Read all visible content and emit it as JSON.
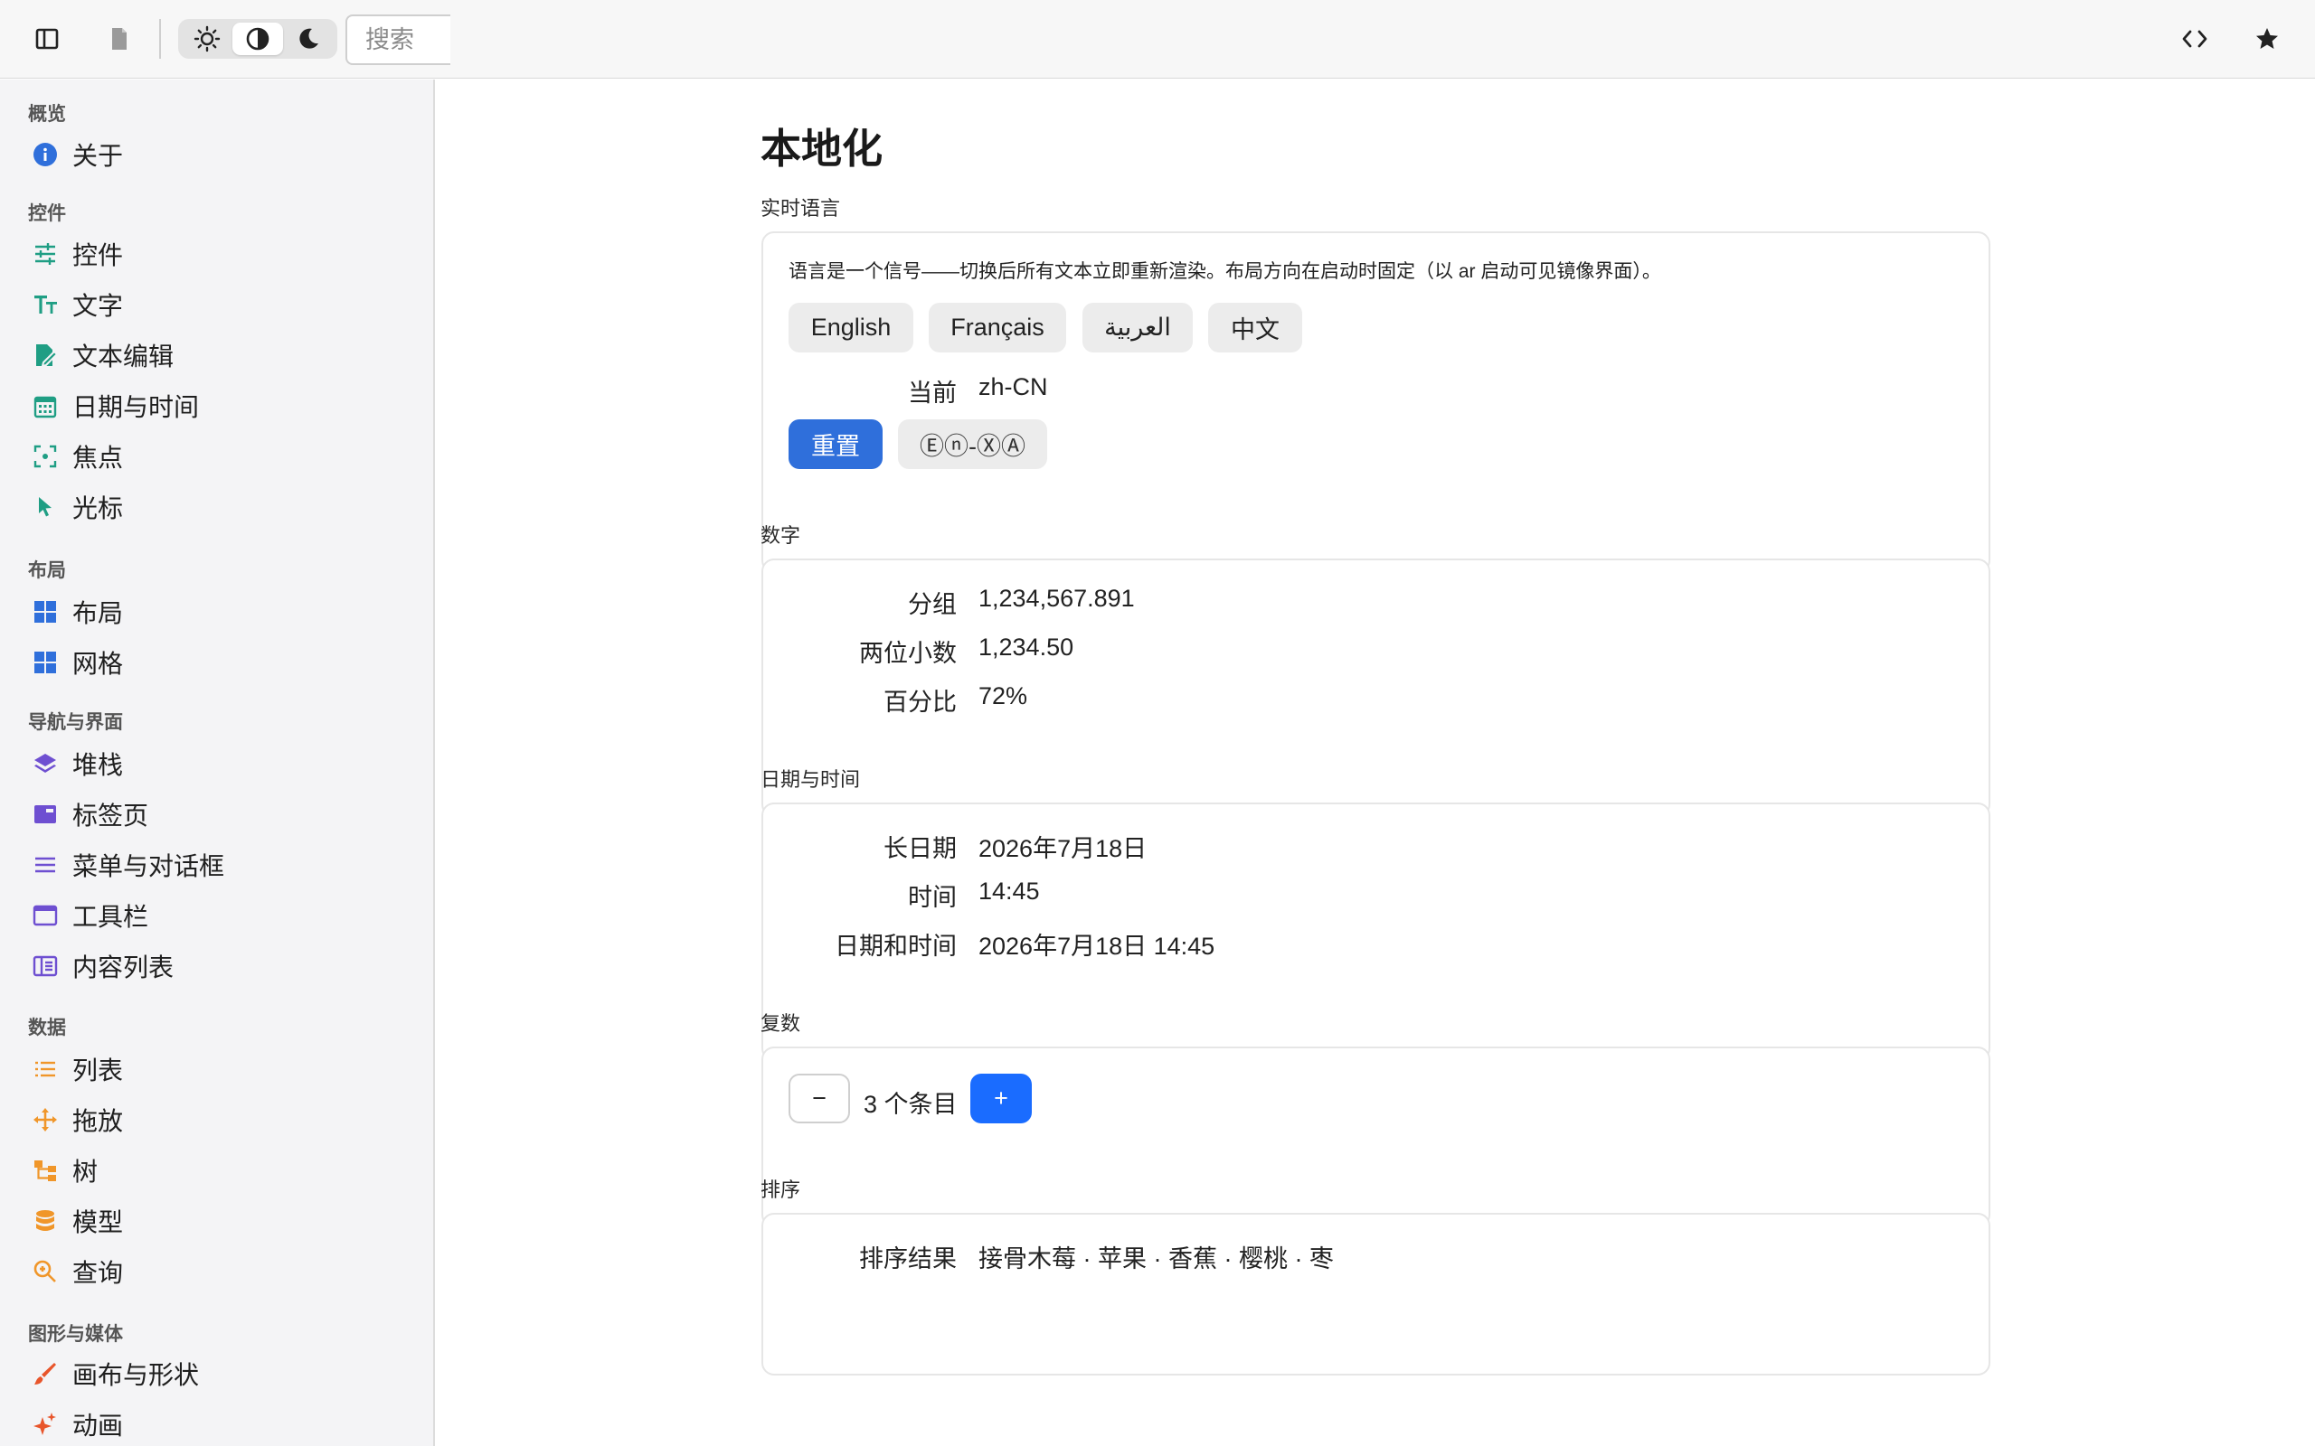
{
  "toolbar": {
    "search_placeholder": "搜索"
  },
  "sidebar": {
    "sections": [
      {
        "title": "概览",
        "items": [
          {
            "label": "关于",
            "icon": "info-icon",
            "color": "#2f6fdb"
          }
        ]
      },
      {
        "title": "控件",
        "items": [
          {
            "label": "控件",
            "icon": "sliders-icon",
            "color": "#1f9e84"
          },
          {
            "label": "文字",
            "icon": "text-icon",
            "color": "#1f9e84"
          },
          {
            "label": "文本编辑",
            "icon": "edit-document-icon",
            "color": "#1f9e84"
          },
          {
            "label": "日期与时间",
            "icon": "calendar-icon",
            "color": "#1f9e84"
          },
          {
            "label": "焦点",
            "icon": "focus-icon",
            "color": "#1f9e84"
          },
          {
            "label": "光标",
            "icon": "cursor-icon",
            "color": "#1f9e84"
          }
        ]
      },
      {
        "title": "布局",
        "items": [
          {
            "label": "布局",
            "icon": "layout-icon",
            "color": "#2f6fdb"
          },
          {
            "label": "网格",
            "icon": "grid-icon",
            "color": "#2f6fdb"
          }
        ]
      },
      {
        "title": "导航与界面",
        "items": [
          {
            "label": "堆栈",
            "icon": "layers-icon",
            "color": "#6e4fd1"
          },
          {
            "label": "标签页",
            "icon": "tabs-icon",
            "color": "#6e4fd1"
          },
          {
            "label": "菜单与对话框",
            "icon": "menu-icon",
            "color": "#6e4fd1"
          },
          {
            "label": "工具栏",
            "icon": "toolbar-icon",
            "color": "#6e4fd1"
          },
          {
            "label": "内容列表",
            "icon": "content-list-icon",
            "color": "#6e4fd1"
          }
        ]
      },
      {
        "title": "数据",
        "items": [
          {
            "label": "列表",
            "icon": "list-icon",
            "color": "#f0962a"
          },
          {
            "label": "拖放",
            "icon": "move-icon",
            "color": "#f0962a"
          },
          {
            "label": "树",
            "icon": "tree-icon",
            "color": "#f0962a"
          },
          {
            "label": "模型",
            "icon": "database-icon",
            "color": "#f0962a"
          },
          {
            "label": "查询",
            "icon": "query-icon",
            "color": "#f0962a"
          }
        ]
      },
      {
        "title": "图形与媒体",
        "items": [
          {
            "label": "画布与形状",
            "icon": "brush-icon",
            "color": "#e8552b"
          },
          {
            "label": "动画",
            "icon": "sparkle-icon",
            "color": "#e8552b"
          }
        ]
      }
    ]
  },
  "main": {
    "title": "本地化",
    "live_language": {
      "label": "实时语言",
      "description": "语言是一个信号——切换后所有文本立即重新渲染。布局方向在启动时固定（以 ar 启动可见镜像界面）。",
      "languages": [
        "English",
        "Français",
        "العربية",
        "中文"
      ],
      "current_key": "当前",
      "current_value": "zh-CN",
      "reset_label": "重置",
      "pseudo_label": "Ⓔⓝ-ⓍⒶ"
    },
    "numbers": {
      "label": "数字",
      "rows": [
        {
          "key": "分组",
          "value": "1,234,567.891"
        },
        {
          "key": "两位小数",
          "value": "1,234.50"
        },
        {
          "key": "百分比",
          "value": "72%"
        }
      ]
    },
    "datetime": {
      "label": "日期与时间",
      "rows": [
        {
          "key": "长日期",
          "value": "2026年7月18日"
        },
        {
          "key": "时间",
          "value": "14:45"
        },
        {
          "key": "日期和时间",
          "value": "2026年7月18日 14:45"
        }
      ]
    },
    "plural": {
      "label": "复数",
      "minus": "−",
      "count_text": "3 个条目",
      "plus": "+"
    },
    "sorting": {
      "label": "排序",
      "key": "排序结果",
      "value": "接骨木莓 · 苹果 · 香蕉 · 樱桃 · 枣"
    }
  }
}
